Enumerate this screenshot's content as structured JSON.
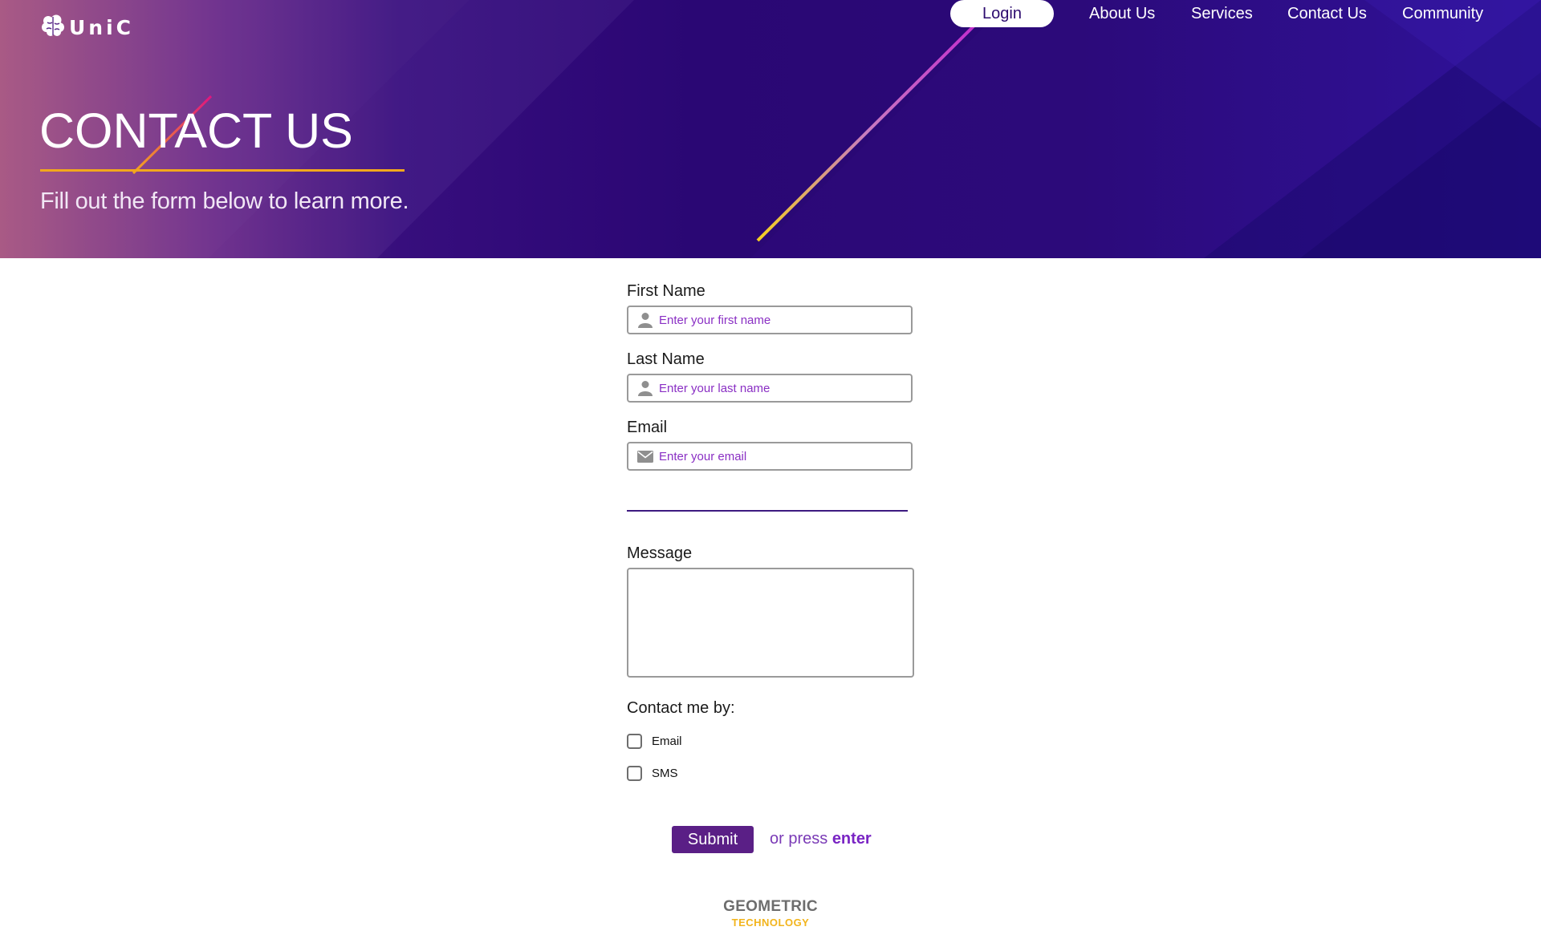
{
  "header": {
    "brand": "UniC",
    "login_label": "Login",
    "nav": [
      "About Us",
      "Services",
      "Contact Us",
      "Community"
    ]
  },
  "hero": {
    "title": "CONTACT US",
    "subtitle": "Fill out the form below to learn more."
  },
  "form": {
    "first_name": {
      "label": "First Name",
      "placeholder": "Enter your first name",
      "value": ""
    },
    "last_name": {
      "label": "Last Name",
      "placeholder": "Enter your last name",
      "value": ""
    },
    "email": {
      "label": "Email",
      "placeholder": "Enter your email",
      "value": ""
    },
    "message": {
      "label": "Message",
      "value": ""
    },
    "contact_by": {
      "label": "Contact me by:",
      "options": [
        {
          "label": "Email",
          "checked": false
        },
        {
          "label": "SMS",
          "checked": false
        }
      ]
    },
    "submit_label": "Submit",
    "press_prefix": "or press",
    "press_key": "enter"
  },
  "footer": {
    "line1": "GEOMETRIC",
    "line2": "TECHNOLOGY"
  },
  "colors": {
    "hero_gradient": [
      "#a5527f",
      "#2c0877",
      "#2f129a"
    ],
    "accent_orange": "#f2a81c",
    "button_purple": "#5a1f86",
    "placeholder_purple": "#8a2fc4"
  },
  "icons": [
    "brain-logo-icon",
    "person-icon",
    "envelope-icon"
  ]
}
